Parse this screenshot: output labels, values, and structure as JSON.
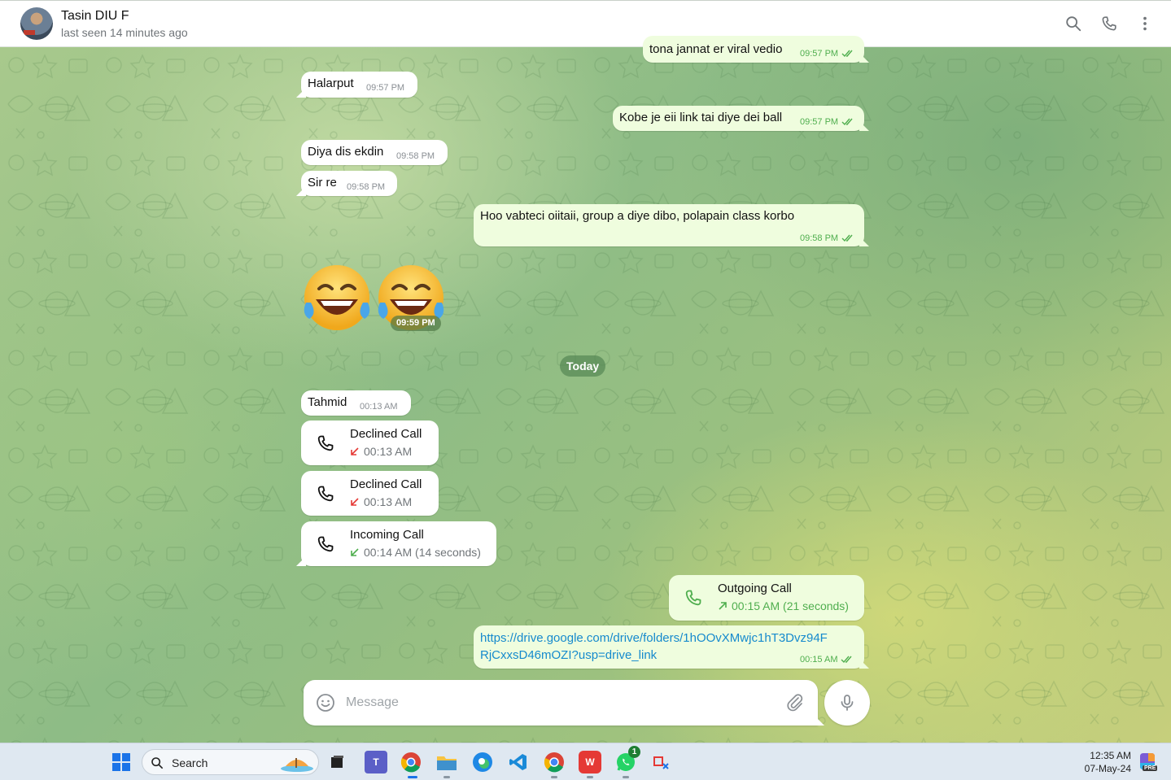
{
  "header": {
    "contact_name": "Tasin DIU F",
    "status": "last seen 14 minutes ago"
  },
  "messages": [
    {
      "dir": "out",
      "text": "tona jannat er viral vedio",
      "time": "09:57 PM"
    },
    {
      "dir": "in",
      "text": "Halarput",
      "time": "09:57 PM"
    },
    {
      "dir": "out",
      "text": "Kobe je eii link tai diye dei ball",
      "time": "09:57 PM"
    },
    {
      "dir": "in",
      "text": "Diya dis ekdin",
      "time": "09:58 PM"
    },
    {
      "dir": "in",
      "text": "Sir re",
      "time": "09:58 PM"
    },
    {
      "dir": "out",
      "text": "Hoo vabteci oiitaii,  group a diye dibo,  polapain class korbo",
      "time": "09:58 PM"
    },
    {
      "dir": "in",
      "type": "emoji",
      "emoji_name": "face-with-tears-of-joy",
      "count": 2,
      "time": "09:59 PM"
    },
    {
      "dir": "in",
      "text": "Tahmid",
      "time": "00:13 AM"
    }
  ],
  "date_separator": "Today",
  "calls": [
    {
      "dir": "in",
      "title": "Declined Call",
      "detail": "00:13 AM",
      "arrow": "missed"
    },
    {
      "dir": "in",
      "title": "Declined Call",
      "detail": "00:13 AM",
      "arrow": "missed"
    },
    {
      "dir": "in",
      "title": "Incoming Call",
      "detail": "00:14 AM (14 seconds)",
      "arrow": "incoming"
    },
    {
      "dir": "out",
      "title": "Outgoing Call",
      "detail": "00:15 AM (21 seconds)",
      "arrow": "outgoing"
    }
  ],
  "link_message": {
    "line1": "https://drive.google.com/drive/folders/1hOOvXMwjc1hT3Dvz94F",
    "line2": "RjCxxsD46mOZI?usp=drive_link",
    "time": "00:15 AM"
  },
  "composer": {
    "placeholder": "Message"
  },
  "taskbar": {
    "search_label": "Search",
    "time": "12:35 AM",
    "date": "07-May-24",
    "whatsapp_badge": "1",
    "copilot_badge": "PRE"
  },
  "colors": {
    "outgoing_bubble": "#effdde",
    "incoming_bubble": "#ffffff",
    "accent_green": "#4fae4e",
    "missed_red": "#e53935",
    "link_blue": "#168acd"
  }
}
